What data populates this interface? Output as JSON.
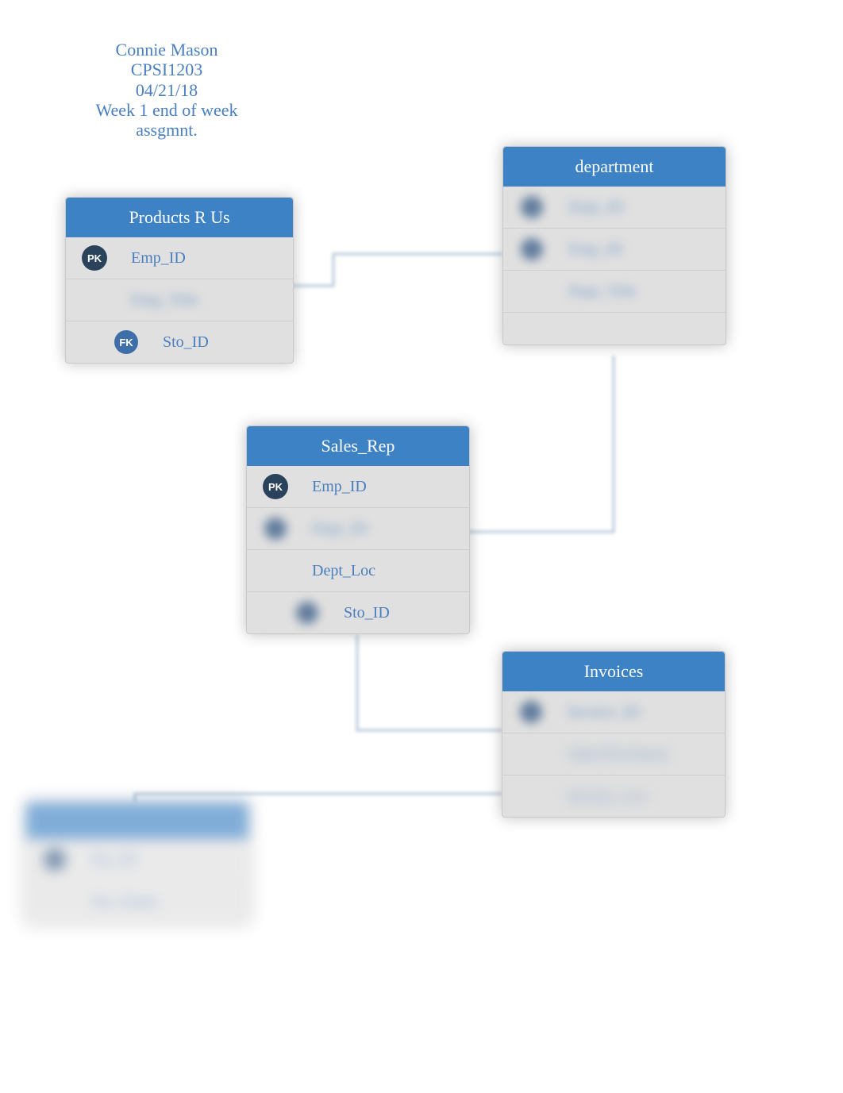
{
  "header": {
    "line1": "Connie Mason",
    "line2": "CPSI1203",
    "line3": "04/21/18",
    "line4": "Week 1 end of week assgmnt."
  },
  "entities": {
    "products": {
      "title": "Products R Us",
      "rows": [
        {
          "key": "PK",
          "name": "Emp_ID"
        },
        {
          "key": "",
          "name": "Emp_Title",
          "blurred": true
        },
        {
          "key": "FK",
          "name": "Sto_ID",
          "fk_indent": true
        }
      ]
    },
    "department": {
      "title": "department",
      "rows": [
        {
          "key": "dot",
          "name": "Dept_ID",
          "blurred": true
        },
        {
          "key": "dot",
          "name": "Emp_ID",
          "blurred": true
        },
        {
          "key": "",
          "name": "Dept_Title",
          "blurred": true
        }
      ]
    },
    "salesrep": {
      "title": "Sales_Rep",
      "rows": [
        {
          "key": "PK",
          "name": "Emp_ID"
        },
        {
          "key": "dot",
          "name": "Dept_ID",
          "blurred": true
        },
        {
          "key": "",
          "name": "Dept_Loc"
        },
        {
          "key": "fk-dot",
          "name": "Sto_ID",
          "fk_indent": true
        }
      ]
    },
    "invoices": {
      "title": "Invoices",
      "rows": [
        {
          "key": "dot",
          "name": "Invoice_ID",
          "blurred": true
        },
        {
          "key": "",
          "name": "Sales/Purchases",
          "blurred": true
        },
        {
          "key": "",
          "name": "Invoice_Loc",
          "blurred": true
        }
      ]
    },
    "unknown": {
      "title": "",
      "rows": [
        {
          "key": "dot",
          "name": "Sto_ID",
          "blurred": true
        },
        {
          "key": "",
          "name": "Sto_Name",
          "blurred": true
        }
      ]
    }
  }
}
